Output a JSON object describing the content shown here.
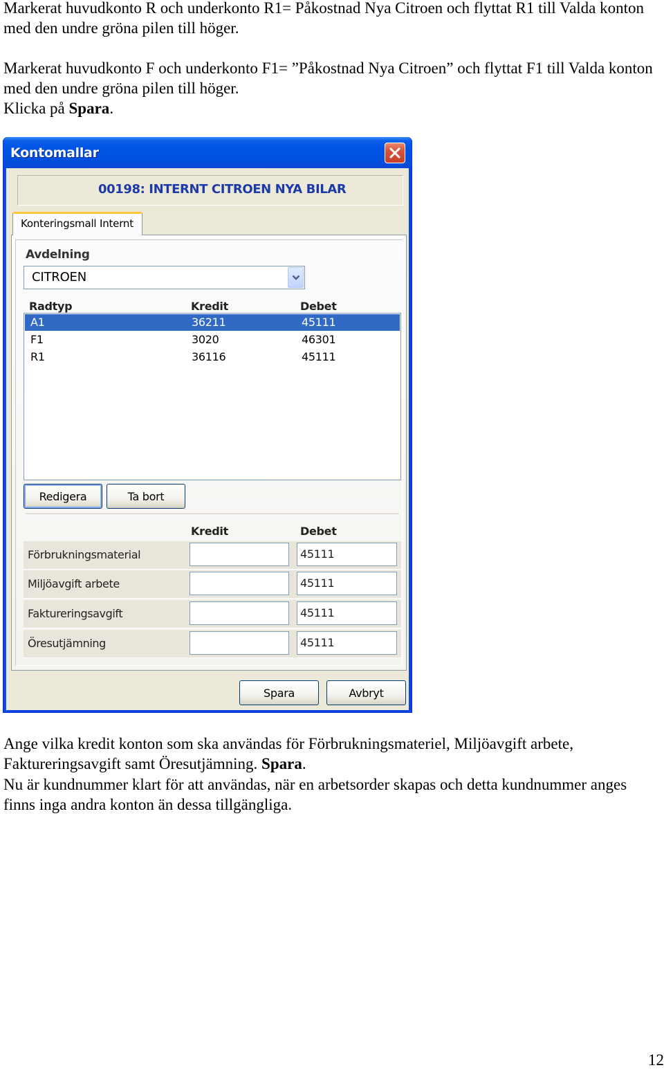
{
  "doc": {
    "para1": "Markerat huvudkonto R och underkonto R1= Påkostnad Nya Citroen och flyttat R1 till Valda konton med den undre gröna pilen till höger.",
    "para2": "Markerat huvudkonto F och underkonto F1= ”Påkostnad Nya Citroen” och flyttat F1 till Valda konton med den undre gröna pilen till höger.",
    "para3_prefix": "Klicka på ",
    "para3_bold": "Spara",
    "para3_suffix": ".",
    "para4_text": "Ange vilka kredit konton som ska användas för Förbrukningsmateriel, Miljöavgift arbete, Faktureringsavgift samt Öresutjämning. ",
    "para4_bold": "Spara",
    "para4_suffix": ".",
    "para5": "Nu är kundnummer klart för att användas, när en arbetsorder skapas och detta kundnummer anges finns inga andra konton än dessa tillgängliga.",
    "page_number": "12"
  },
  "dialog": {
    "title": "Kontomallar",
    "close_icon": "close-icon",
    "header": "00198: INTERNT CITROEN NYA BILAR",
    "tab_label": "Konteringsmall Internt",
    "avdelning_label": "Avdelning",
    "avdelning_value": "CITROEN",
    "list_headers": {
      "radtyp": "Radtyp",
      "kredit": "Kredit",
      "debet": "Debet"
    },
    "list_rows": [
      {
        "radtyp": "A1",
        "kredit": "36211",
        "debet": "45111",
        "selected": true
      },
      {
        "radtyp": "F1",
        "kredit": "3020",
        "debet": "46301",
        "selected": false
      },
      {
        "radtyp": "R1",
        "kredit": "36116",
        "debet": "45111",
        "selected": false
      }
    ],
    "edit_button": "Redigera",
    "delete_button": "Ta bort",
    "account_headers": {
      "kredit": "Kredit",
      "debet": "Debet"
    },
    "account_rows": [
      {
        "label": "Förbrukningsmaterial",
        "kredit": "",
        "debet": "45111"
      },
      {
        "label": "Miljöavgift arbete",
        "kredit": "",
        "debet": "45111"
      },
      {
        "label": "Faktureringsavgift",
        "kredit": "",
        "debet": "45111"
      },
      {
        "label": "Öresutjämning",
        "kredit": "",
        "debet": "45111"
      }
    ],
    "save_button": "Spara",
    "cancel_button": "Avbryt"
  },
  "colors": {
    "title_bar": "#0053e4",
    "selection": "#316ac5",
    "header_text": "#1c3aa8",
    "window_bg": "#ece9d8"
  }
}
